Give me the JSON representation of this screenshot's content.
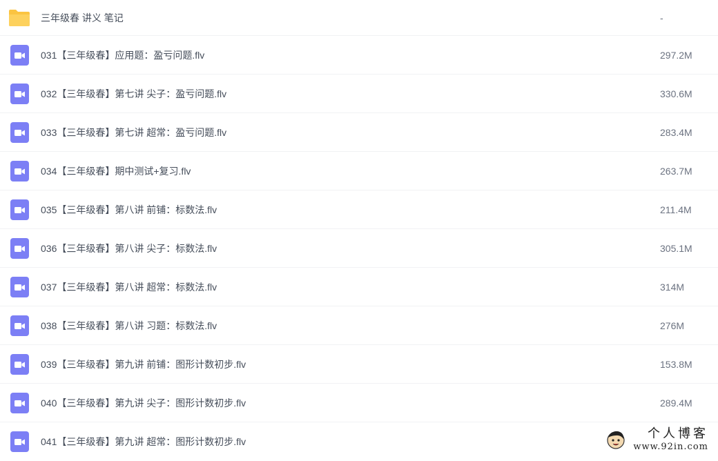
{
  "accent_colors": {
    "video_icon": "#7c7ff5",
    "folder_icon": "#fdd15d",
    "text": "#454d5a",
    "size_text": "#6b7280",
    "divider": "#f1f2f4"
  },
  "files": [
    {
      "type": "folder",
      "icon": "folder-icon",
      "name": "三年级春 讲义 笔记",
      "size": "-"
    },
    {
      "type": "video",
      "icon": "video-file-icon",
      "name": "031【三年级春】应用题：盈亏问题.flv",
      "size": "297.2M"
    },
    {
      "type": "video",
      "icon": "video-file-icon",
      "name": "032【三年级春】第七讲 尖子：盈亏问题.flv",
      "size": "330.6M"
    },
    {
      "type": "video",
      "icon": "video-file-icon",
      "name": "033【三年级春】第七讲 超常：盈亏问题.flv",
      "size": "283.4M"
    },
    {
      "type": "video",
      "icon": "video-file-icon",
      "name": "034【三年级春】期中测试+复习.flv",
      "size": "263.7M"
    },
    {
      "type": "video",
      "icon": "video-file-icon",
      "name": "035【三年级春】第八讲 前铺：标数法.flv",
      "size": "211.4M"
    },
    {
      "type": "video",
      "icon": "video-file-icon",
      "name": "036【三年级春】第八讲 尖子：标数法.flv",
      "size": "305.1M"
    },
    {
      "type": "video",
      "icon": "video-file-icon",
      "name": "037【三年级春】第八讲 超常：标数法.flv",
      "size": "314M"
    },
    {
      "type": "video",
      "icon": "video-file-icon",
      "name": "038【三年级春】第八讲 习题：标数法.flv",
      "size": "276M"
    },
    {
      "type": "video",
      "icon": "video-file-icon",
      "name": "039【三年级春】第九讲 前铺：图形计数初步.flv",
      "size": "153.8M"
    },
    {
      "type": "video",
      "icon": "video-file-icon",
      "name": "040【三年级春】第九讲 尖子：图形计数初步.flv",
      "size": "289.4M"
    },
    {
      "type": "video",
      "icon": "video-file-icon",
      "name": "041【三年级春】第九讲 超常：图形计数初步.flv",
      "size": "..."
    }
  ],
  "watermark": {
    "title": "个人博客",
    "url": "www.92in.com"
  }
}
